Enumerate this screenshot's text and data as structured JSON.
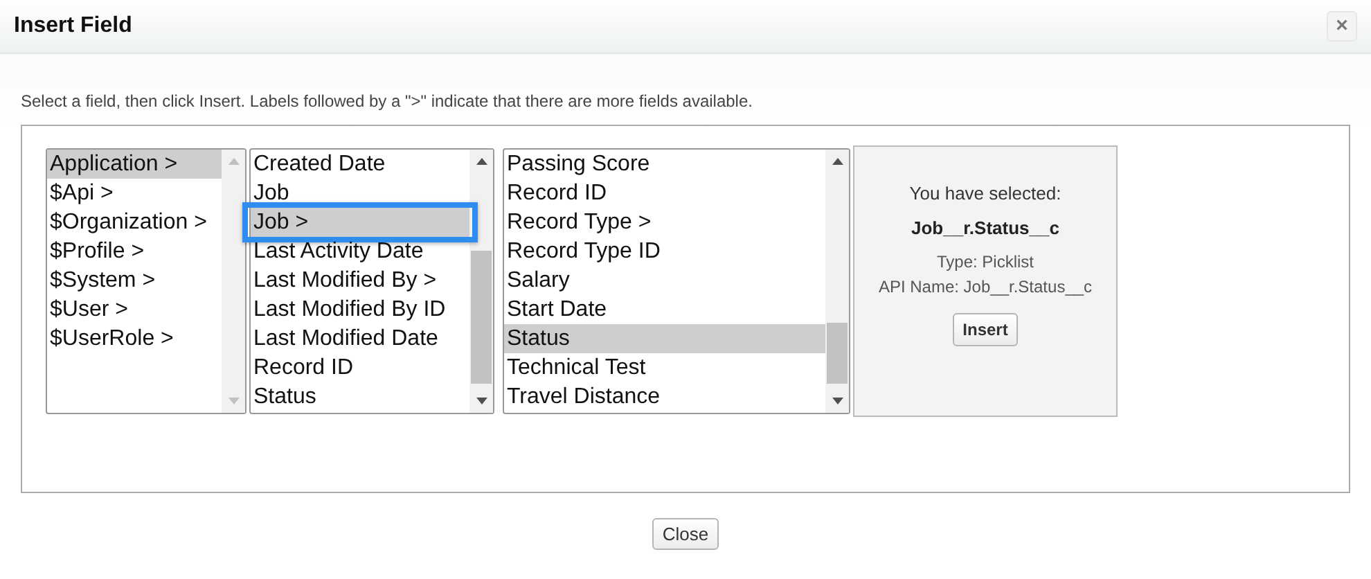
{
  "window": {
    "title": "Insert Field",
    "close_label": "×"
  },
  "instructions": "Select a field, then click Insert. Labels followed by a \">\" indicate that there are more fields available.",
  "lists": [
    {
      "items": [
        {
          "label": "Application >",
          "selected": true,
          "highlighted": false
        },
        {
          "label": "$Api >",
          "selected": false,
          "highlighted": false
        },
        {
          "label": "$Organization >",
          "selected": false,
          "highlighted": false
        },
        {
          "label": "$Profile >",
          "selected": false,
          "highlighted": false
        },
        {
          "label": "$System >",
          "selected": false,
          "highlighted": false
        },
        {
          "label": "$User >",
          "selected": false,
          "highlighted": false
        },
        {
          "label": "$UserRole >",
          "selected": false,
          "highlighted": false
        }
      ]
    },
    {
      "items": [
        {
          "label": "Created Date",
          "selected": false,
          "highlighted": false
        },
        {
          "label": "Job",
          "selected": false,
          "highlighted": false
        },
        {
          "label": "Job >",
          "selected": true,
          "highlighted": true
        },
        {
          "label": "Last Activity Date",
          "selected": false,
          "highlighted": false
        },
        {
          "label": "Last Modified By >",
          "selected": false,
          "highlighted": false
        },
        {
          "label": "Last Modified By ID",
          "selected": false,
          "highlighted": false
        },
        {
          "label": "Last Modified Date",
          "selected": false,
          "highlighted": false
        },
        {
          "label": "Record ID",
          "selected": false,
          "highlighted": false
        },
        {
          "label": "Status",
          "selected": false,
          "highlighted": false
        }
      ]
    },
    {
      "items": [
        {
          "label": "Passing Score",
          "selected": false,
          "highlighted": false
        },
        {
          "label": "Record ID",
          "selected": false,
          "highlighted": false
        },
        {
          "label": "Record Type >",
          "selected": false,
          "highlighted": false
        },
        {
          "label": "Record Type ID",
          "selected": false,
          "highlighted": false
        },
        {
          "label": "Salary",
          "selected": false,
          "highlighted": false
        },
        {
          "label": "Start Date",
          "selected": false,
          "highlighted": false
        },
        {
          "label": "Status",
          "selected": true,
          "highlighted": false
        },
        {
          "label": "Technical Test",
          "selected": false,
          "highlighted": false
        },
        {
          "label": "Travel Distance",
          "selected": false,
          "highlighted": false
        }
      ]
    }
  ],
  "selection": {
    "heading": "You have selected:",
    "field": "Job__r.Status__c",
    "type": "Type: Picklist",
    "api_name": "API Name: Job__r.Status__c",
    "button": "Insert"
  },
  "footer_button": "Close"
}
